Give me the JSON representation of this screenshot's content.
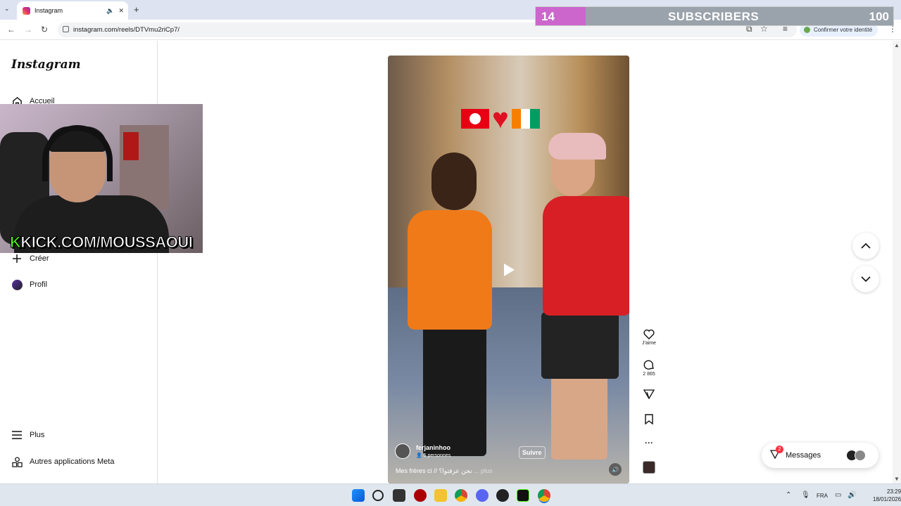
{
  "browser": {
    "tab_title": "Instagram",
    "tab_audio_icon": "speaker-icon",
    "tab_close": "✕",
    "new_tab": "+",
    "url": "instagram.com/reels/DTVmu2riCp7/",
    "verify_label": "Confirmer votre identité"
  },
  "overlay": {
    "subscribers_current": "14",
    "subscribers_label": "SUBSCRIBERS",
    "subscribers_goal": "100",
    "subscribers_progress": 0.14
  },
  "webcam": {
    "kick_prefix": "K",
    "kick_text": "KICK.COM/MOUSSAOUI"
  },
  "sidebar": {
    "logo": "Instagram",
    "items": [
      {
        "label": "Accueil",
        "icon": "home-icon"
      },
      {
        "label": "Créer",
        "icon": "plus-icon"
      },
      {
        "label": "Profil",
        "icon": "profile-avatar-icon"
      },
      {
        "label": "Plus",
        "icon": "menu-icon"
      },
      {
        "label": "Autres applications Meta",
        "icon": "apps-icon"
      }
    ]
  },
  "reel": {
    "username": "ferjaninhoo",
    "people": "5 personnes",
    "follow_label": "Suivre",
    "caption": "Mes frères ci // نحن عرفتوا؟",
    "more_label": "... plus"
  },
  "actions": {
    "like_label": "J'aime",
    "comments_count": "2 865"
  },
  "messages": {
    "label": "Messages",
    "badge": "2"
  },
  "taskbar": {
    "lang": "FRA",
    "time": "23:29",
    "date": "18/01/2026"
  },
  "colors": {
    "subscribers_fill": "#cc66cc",
    "kick_green": "#53fc18",
    "notification_red": "#ff3040"
  }
}
